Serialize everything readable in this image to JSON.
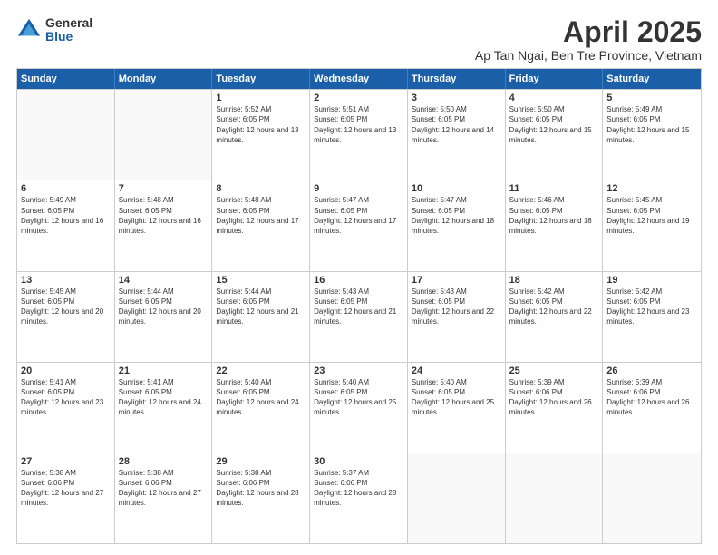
{
  "logo": {
    "general": "General",
    "blue": "Blue"
  },
  "title": "April 2025",
  "subtitle": "Ap Tan Ngai, Ben Tre Province, Vietnam",
  "headers": [
    "Sunday",
    "Monday",
    "Tuesday",
    "Wednesday",
    "Thursday",
    "Friday",
    "Saturday"
  ],
  "weeks": [
    [
      {
        "day": "",
        "sunrise": "",
        "sunset": "",
        "daylight": "",
        "empty": true
      },
      {
        "day": "",
        "sunrise": "",
        "sunset": "",
        "daylight": "",
        "empty": true
      },
      {
        "day": "1",
        "sunrise": "Sunrise: 5:52 AM",
        "sunset": "Sunset: 6:05 PM",
        "daylight": "Daylight: 12 hours and 13 minutes."
      },
      {
        "day": "2",
        "sunrise": "Sunrise: 5:51 AM",
        "sunset": "Sunset: 6:05 PM",
        "daylight": "Daylight: 12 hours and 13 minutes."
      },
      {
        "day": "3",
        "sunrise": "Sunrise: 5:50 AM",
        "sunset": "Sunset: 6:05 PM",
        "daylight": "Daylight: 12 hours and 14 minutes."
      },
      {
        "day": "4",
        "sunrise": "Sunrise: 5:50 AM",
        "sunset": "Sunset: 6:05 PM",
        "daylight": "Daylight: 12 hours and 15 minutes."
      },
      {
        "day": "5",
        "sunrise": "Sunrise: 5:49 AM",
        "sunset": "Sunset: 6:05 PM",
        "daylight": "Daylight: 12 hours and 15 minutes."
      }
    ],
    [
      {
        "day": "6",
        "sunrise": "Sunrise: 5:49 AM",
        "sunset": "Sunset: 6:05 PM",
        "daylight": "Daylight: 12 hours and 16 minutes."
      },
      {
        "day": "7",
        "sunrise": "Sunrise: 5:48 AM",
        "sunset": "Sunset: 6:05 PM",
        "daylight": "Daylight: 12 hours and 16 minutes."
      },
      {
        "day": "8",
        "sunrise": "Sunrise: 5:48 AM",
        "sunset": "Sunset: 6:05 PM",
        "daylight": "Daylight: 12 hours and 17 minutes."
      },
      {
        "day": "9",
        "sunrise": "Sunrise: 5:47 AM",
        "sunset": "Sunset: 6:05 PM",
        "daylight": "Daylight: 12 hours and 17 minutes."
      },
      {
        "day": "10",
        "sunrise": "Sunrise: 5:47 AM",
        "sunset": "Sunset: 6:05 PM",
        "daylight": "Daylight: 12 hours and 18 minutes."
      },
      {
        "day": "11",
        "sunrise": "Sunrise: 5:46 AM",
        "sunset": "Sunset: 6:05 PM",
        "daylight": "Daylight: 12 hours and 18 minutes."
      },
      {
        "day": "12",
        "sunrise": "Sunrise: 5:45 AM",
        "sunset": "Sunset: 6:05 PM",
        "daylight": "Daylight: 12 hours and 19 minutes."
      }
    ],
    [
      {
        "day": "13",
        "sunrise": "Sunrise: 5:45 AM",
        "sunset": "Sunset: 6:05 PM",
        "daylight": "Daylight: 12 hours and 20 minutes."
      },
      {
        "day": "14",
        "sunrise": "Sunrise: 5:44 AM",
        "sunset": "Sunset: 6:05 PM",
        "daylight": "Daylight: 12 hours and 20 minutes."
      },
      {
        "day": "15",
        "sunrise": "Sunrise: 5:44 AM",
        "sunset": "Sunset: 6:05 PM",
        "daylight": "Daylight: 12 hours and 21 minutes."
      },
      {
        "day": "16",
        "sunrise": "Sunrise: 5:43 AM",
        "sunset": "Sunset: 6:05 PM",
        "daylight": "Daylight: 12 hours and 21 minutes."
      },
      {
        "day": "17",
        "sunrise": "Sunrise: 5:43 AM",
        "sunset": "Sunset: 6:05 PM",
        "daylight": "Daylight: 12 hours and 22 minutes."
      },
      {
        "day": "18",
        "sunrise": "Sunrise: 5:42 AM",
        "sunset": "Sunset: 6:05 PM",
        "daylight": "Daylight: 12 hours and 22 minutes."
      },
      {
        "day": "19",
        "sunrise": "Sunrise: 5:42 AM",
        "sunset": "Sunset: 6:05 PM",
        "daylight": "Daylight: 12 hours and 23 minutes."
      }
    ],
    [
      {
        "day": "20",
        "sunrise": "Sunrise: 5:41 AM",
        "sunset": "Sunset: 6:05 PM",
        "daylight": "Daylight: 12 hours and 23 minutes."
      },
      {
        "day": "21",
        "sunrise": "Sunrise: 5:41 AM",
        "sunset": "Sunset: 6:05 PM",
        "daylight": "Daylight: 12 hours and 24 minutes."
      },
      {
        "day": "22",
        "sunrise": "Sunrise: 5:40 AM",
        "sunset": "Sunset: 6:05 PM",
        "daylight": "Daylight: 12 hours and 24 minutes."
      },
      {
        "day": "23",
        "sunrise": "Sunrise: 5:40 AM",
        "sunset": "Sunset: 6:05 PM",
        "daylight": "Daylight: 12 hours and 25 minutes."
      },
      {
        "day": "24",
        "sunrise": "Sunrise: 5:40 AM",
        "sunset": "Sunset: 6:05 PM",
        "daylight": "Daylight: 12 hours and 25 minutes."
      },
      {
        "day": "25",
        "sunrise": "Sunrise: 5:39 AM",
        "sunset": "Sunset: 6:06 PM",
        "daylight": "Daylight: 12 hours and 26 minutes."
      },
      {
        "day": "26",
        "sunrise": "Sunrise: 5:39 AM",
        "sunset": "Sunset: 6:06 PM",
        "daylight": "Daylight: 12 hours and 26 minutes."
      }
    ],
    [
      {
        "day": "27",
        "sunrise": "Sunrise: 5:38 AM",
        "sunset": "Sunset: 6:06 PM",
        "daylight": "Daylight: 12 hours and 27 minutes."
      },
      {
        "day": "28",
        "sunrise": "Sunrise: 5:38 AM",
        "sunset": "Sunset: 6:06 PM",
        "daylight": "Daylight: 12 hours and 27 minutes."
      },
      {
        "day": "29",
        "sunrise": "Sunrise: 5:38 AM",
        "sunset": "Sunset: 6:06 PM",
        "daylight": "Daylight: 12 hours and 28 minutes."
      },
      {
        "day": "30",
        "sunrise": "Sunrise: 5:37 AM",
        "sunset": "Sunset: 6:06 PM",
        "daylight": "Daylight: 12 hours and 28 minutes."
      },
      {
        "day": "",
        "sunrise": "",
        "sunset": "",
        "daylight": "",
        "empty": true
      },
      {
        "day": "",
        "sunrise": "",
        "sunset": "",
        "daylight": "",
        "empty": true
      },
      {
        "day": "",
        "sunrise": "",
        "sunset": "",
        "daylight": "",
        "empty": true
      }
    ]
  ]
}
